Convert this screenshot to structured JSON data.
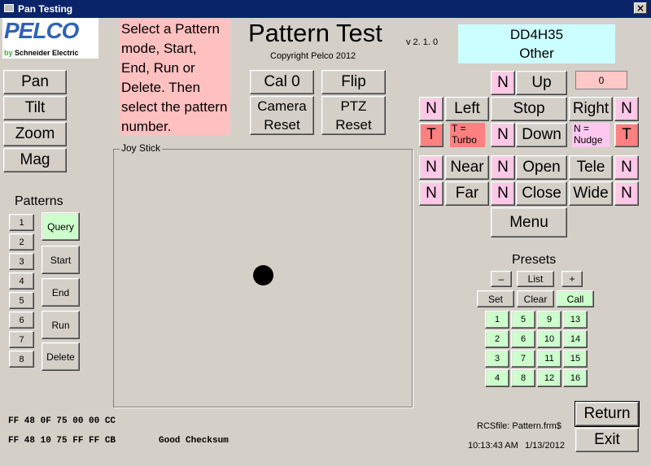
{
  "window": {
    "title": "Pan Testing",
    "close": "×"
  },
  "logo": {
    "brand": "PELCO",
    "by": "by",
    "company": "Schneider Electric"
  },
  "instructions": "Select a Pattern mode, Start, End, Run or Delete. Then select the pattern number.",
  "header": {
    "title": "Pattern Test",
    "copyright": "Copyright Pelco 2012",
    "version": "v 2. 1. 0"
  },
  "device": {
    "id": "DD4H35",
    "type": "Other"
  },
  "left_buttons": {
    "pan": "Pan",
    "tilt": "Tilt",
    "zoom": "Zoom",
    "mag": "Mag"
  },
  "patterns": {
    "heading": "Patterns",
    "numbers": [
      "1",
      "2",
      "3",
      "4",
      "5",
      "6",
      "7",
      "8"
    ],
    "query": "Query",
    "start": "Start",
    "end": "End",
    "run": "Run",
    "delete": "Delete"
  },
  "center_buttons": {
    "cal0": "Cal 0",
    "flip": "Flip",
    "camera_reset": "Camera Reset",
    "ptz_reset": "PTZ Reset"
  },
  "joystick": {
    "label": "Joy Stick"
  },
  "ptz": {
    "counter": "0",
    "n": "N",
    "t": "T",
    "up": "Up",
    "left": "Left",
    "stop": "Stop",
    "right": "Right",
    "down": "Down",
    "turbo_note": "T = Turbo",
    "nudge_note": "N = Nudge",
    "near": "Near",
    "far": "Far",
    "open": "Open",
    "close": "Close",
    "tele": "Tele",
    "wide": "Wide",
    "menu": "Menu"
  },
  "presets": {
    "heading": "Presets",
    "minus": "–",
    "list": "List",
    "plus": "+",
    "set": "Set",
    "clear": "Clear",
    "call": "Call",
    "numbers": [
      "1",
      "5",
      "9",
      "13",
      "2",
      "6",
      "10",
      "14",
      "3",
      "7",
      "11",
      "15",
      "4",
      "8",
      "12",
      "16"
    ]
  },
  "status": {
    "line1": "FF 48 0F 75 00 00 CC",
    "line2": "FF 48 10 75 FF FF CB",
    "checksum": "Good Checksum",
    "rcsfile": "RCSfile: Pattern.frm$",
    "time": "10:13:43 AM",
    "date": "1/13/2012"
  },
  "footer": {
    "return": "Return",
    "exit": "Exit"
  }
}
